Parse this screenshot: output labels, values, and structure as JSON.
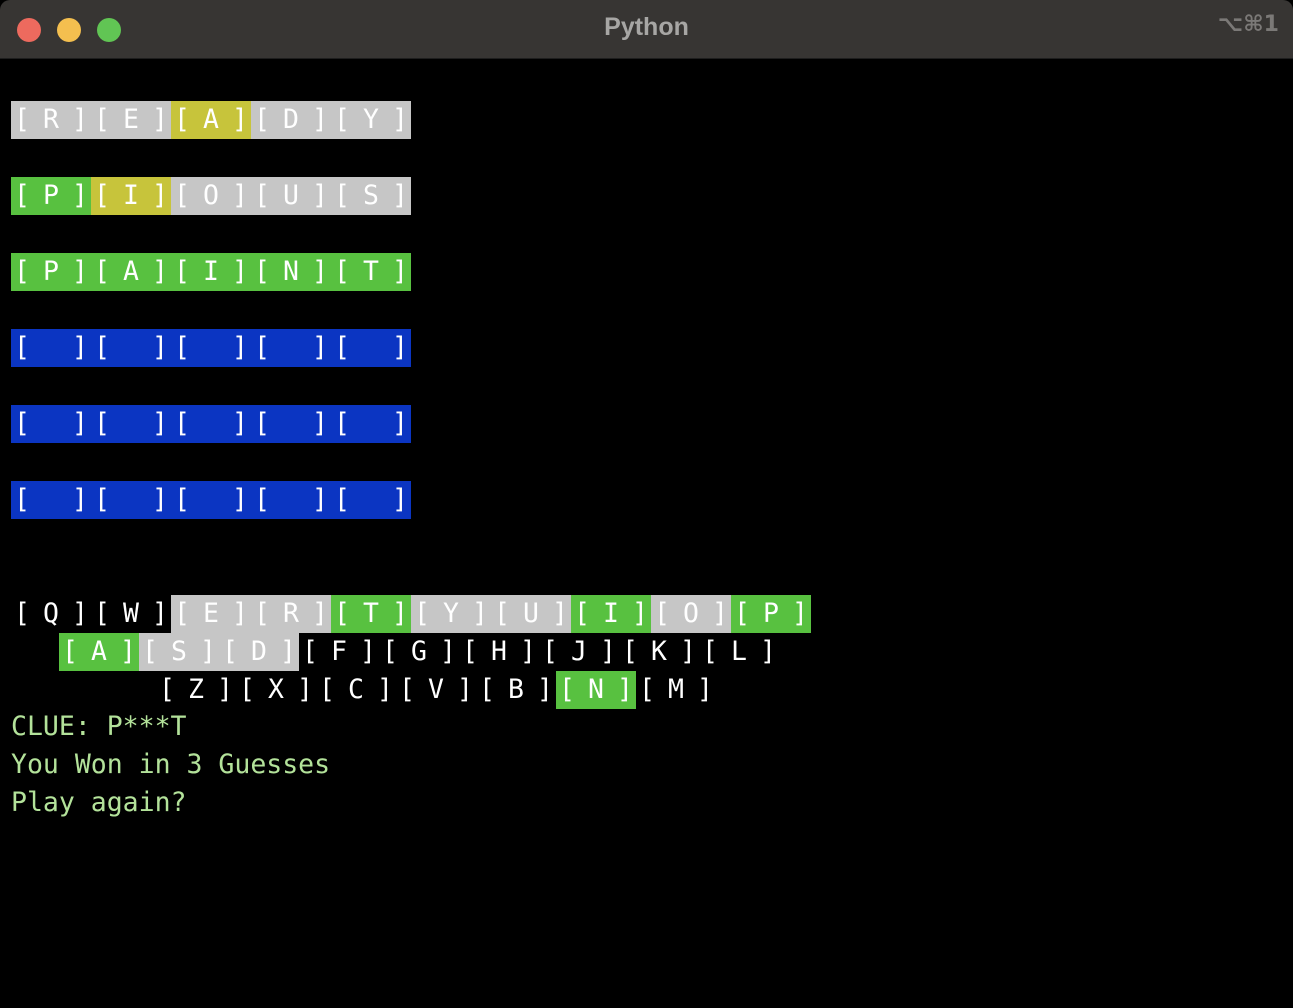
{
  "window": {
    "title": "Python",
    "shortcut": "⌥⌘1"
  },
  "colors": {
    "gray": "#c6c6c6",
    "yellow": "#c7c43b",
    "green": "#58c140",
    "blue": "#0b35c2",
    "message": "#b3e29a"
  },
  "board": [
    [
      {
        "l": "R",
        "c": "gray"
      },
      {
        "l": "E",
        "c": "gray"
      },
      {
        "l": "A",
        "c": "yellow"
      },
      {
        "l": "D",
        "c": "gray"
      },
      {
        "l": "Y",
        "c": "gray"
      }
    ],
    [
      {
        "l": "P",
        "c": "green"
      },
      {
        "l": "I",
        "c": "yellow"
      },
      {
        "l": "O",
        "c": "gray"
      },
      {
        "l": "U",
        "c": "gray"
      },
      {
        "l": "S",
        "c": "gray"
      }
    ],
    [
      {
        "l": "P",
        "c": "green"
      },
      {
        "l": "A",
        "c": "green"
      },
      {
        "l": "I",
        "c": "green"
      },
      {
        "l": "N",
        "c": "green"
      },
      {
        "l": "T",
        "c": "green"
      }
    ],
    [
      {
        "l": "",
        "c": "blue"
      },
      {
        "l": "",
        "c": "blue"
      },
      {
        "l": "",
        "c": "blue"
      },
      {
        "l": "",
        "c": "blue"
      },
      {
        "l": "",
        "c": "blue"
      }
    ],
    [
      {
        "l": "",
        "c": "blue"
      },
      {
        "l": "",
        "c": "blue"
      },
      {
        "l": "",
        "c": "blue"
      },
      {
        "l": "",
        "c": "blue"
      },
      {
        "l": "",
        "c": "blue"
      }
    ],
    [
      {
        "l": "",
        "c": "blue"
      },
      {
        "l": "",
        "c": "blue"
      },
      {
        "l": "",
        "c": "blue"
      },
      {
        "l": "",
        "c": "blue"
      },
      {
        "l": "",
        "c": "blue"
      }
    ]
  ],
  "keyboard": [
    [
      {
        "l": "Q",
        "c": "none"
      },
      {
        "l": "W",
        "c": "none"
      },
      {
        "l": "E",
        "c": "gray"
      },
      {
        "l": "R",
        "c": "gray"
      },
      {
        "l": "T",
        "c": "green"
      },
      {
        "l": "Y",
        "c": "gray"
      },
      {
        "l": "U",
        "c": "gray"
      },
      {
        "l": "I",
        "c": "green"
      },
      {
        "l": "O",
        "c": "gray"
      },
      {
        "l": "P",
        "c": "green"
      }
    ],
    [
      {
        "l": "A",
        "c": "green"
      },
      {
        "l": "S",
        "c": "gray"
      },
      {
        "l": "D",
        "c": "gray"
      },
      {
        "l": "F",
        "c": "none"
      },
      {
        "l": "G",
        "c": "none"
      },
      {
        "l": "H",
        "c": "none"
      },
      {
        "l": "J",
        "c": "none"
      },
      {
        "l": "K",
        "c": "none"
      },
      {
        "l": "L",
        "c": "none"
      }
    ],
    [
      {
        "l": "Z",
        "c": "none"
      },
      {
        "l": "X",
        "c": "none"
      },
      {
        "l": "C",
        "c": "none"
      },
      {
        "l": "V",
        "c": "none"
      },
      {
        "l": "B",
        "c": "none"
      },
      {
        "l": "N",
        "c": "green"
      },
      {
        "l": "M",
        "c": "none"
      }
    ]
  ],
  "messages": {
    "clue": "CLUE: P***T",
    "result": "You Won in 3 Guesses",
    "prompt": "Play again?"
  }
}
